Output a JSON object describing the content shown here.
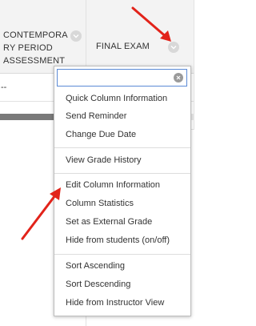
{
  "grid": {
    "columns": [
      {
        "title": "CONTEMPORA\nRY PERIOD\nASSESSMENT"
      },
      {
        "title": "FINAL EXAM"
      }
    ],
    "rows": [
      {
        "cells": [
          "--",
          "--"
        ]
      },
      {
        "cells": [
          "--",
          "--"
        ]
      }
    ]
  },
  "menu": {
    "search": {
      "value": "",
      "placeholder": ""
    },
    "groups": [
      {
        "items": [
          "Quick Column Information",
          "Send Reminder",
          "Change Due Date"
        ]
      },
      {
        "items": [
          "View Grade History"
        ]
      },
      {
        "items": [
          "Edit Column Information",
          "Column Statistics",
          "Set as External Grade",
          "Hide from students (on/off)"
        ]
      },
      {
        "items": [
          "Sort Ascending",
          "Sort Descending",
          "Hide from Instructor View"
        ]
      }
    ]
  },
  "annotations": {
    "arrow_color": "#e2231a"
  },
  "icons": {
    "column_menu": "chevron-down-icon",
    "clear_search": "close-icon"
  }
}
